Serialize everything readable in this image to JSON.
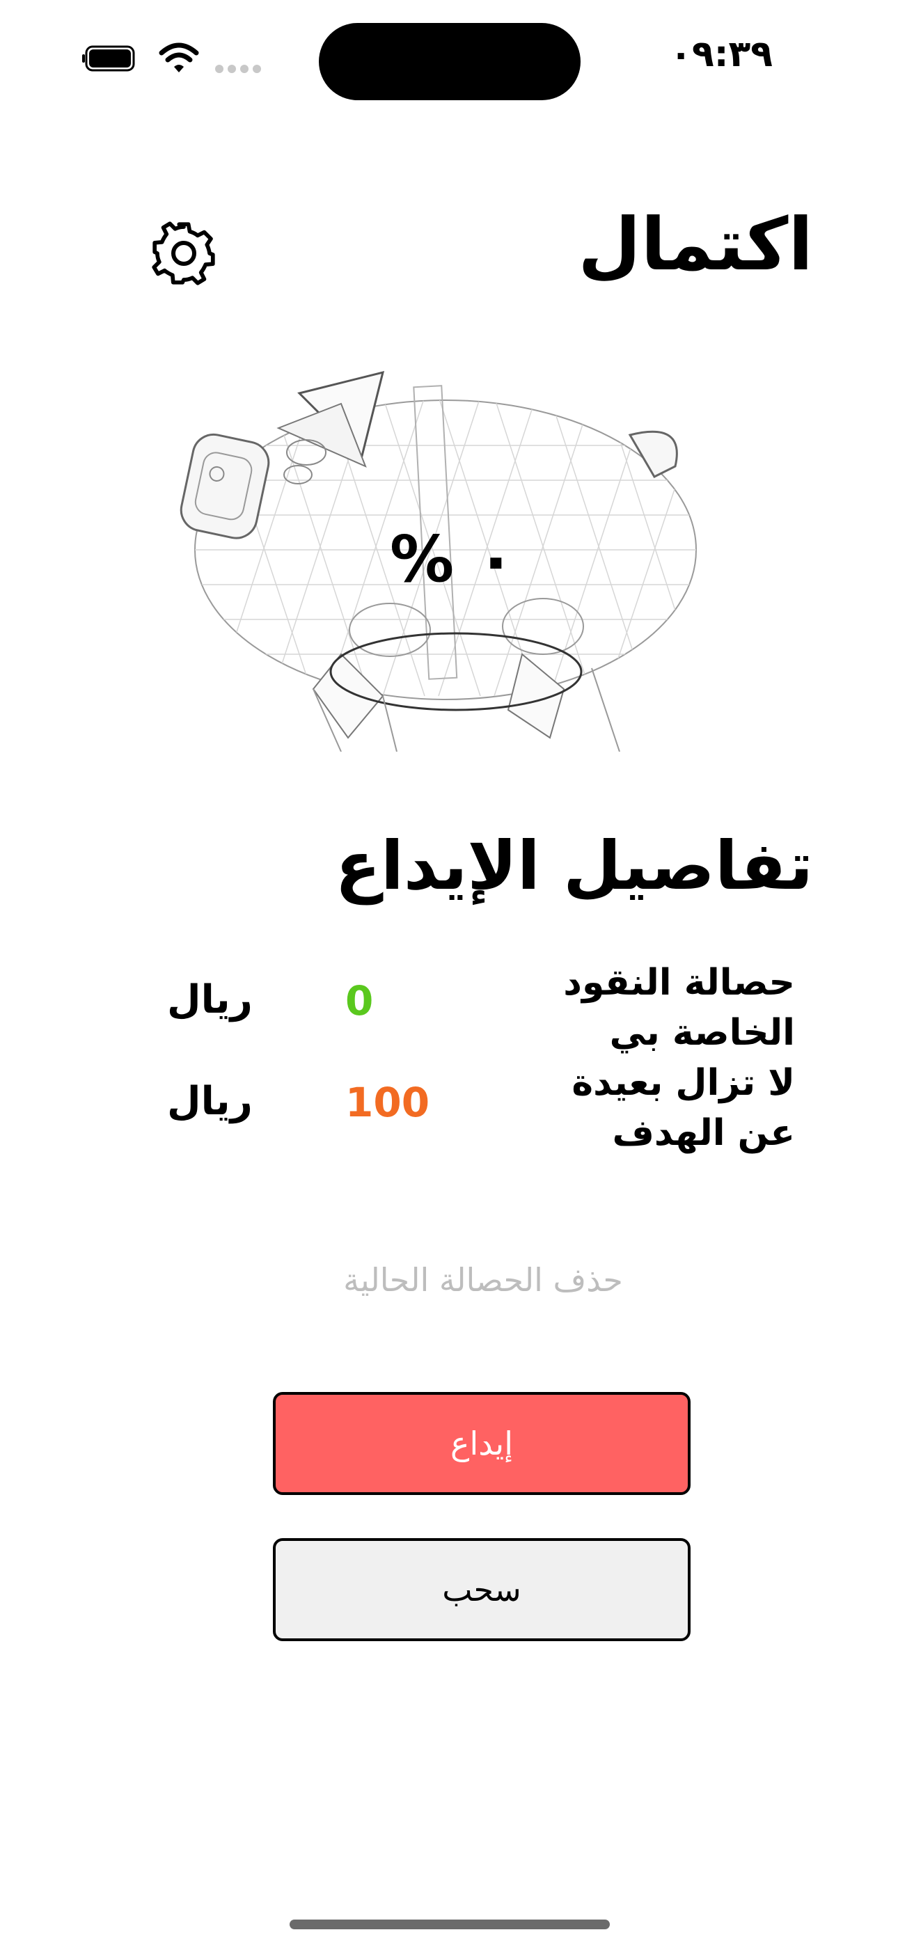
{
  "status_bar": {
    "time": "٠٩:٣٩"
  },
  "header": {
    "title": "اكتمال",
    "settings_icon": "gear-icon"
  },
  "progress": {
    "percent_text": "٠ %",
    "fraction": 0
  },
  "details": {
    "title": "تفاصيل الإيداع",
    "piggy_bank_label": "حصالة النقود الخاصة بي",
    "remaining_label": "لا تزال بعيدة عن الهدف",
    "saved_value": "0",
    "remaining_value": "100",
    "currency": "ريال"
  },
  "actions": {
    "delete_label": "حذف الحصالة الحالية",
    "deposit_label": "إيداع",
    "withdraw_label": "سحب"
  },
  "colors": {
    "saved": "#5ac81e",
    "remaining": "#f26b22",
    "deposit_bg": "#ff6262",
    "withdraw_bg": "#f0f0f0",
    "delete_text": "#bdbdbd"
  }
}
